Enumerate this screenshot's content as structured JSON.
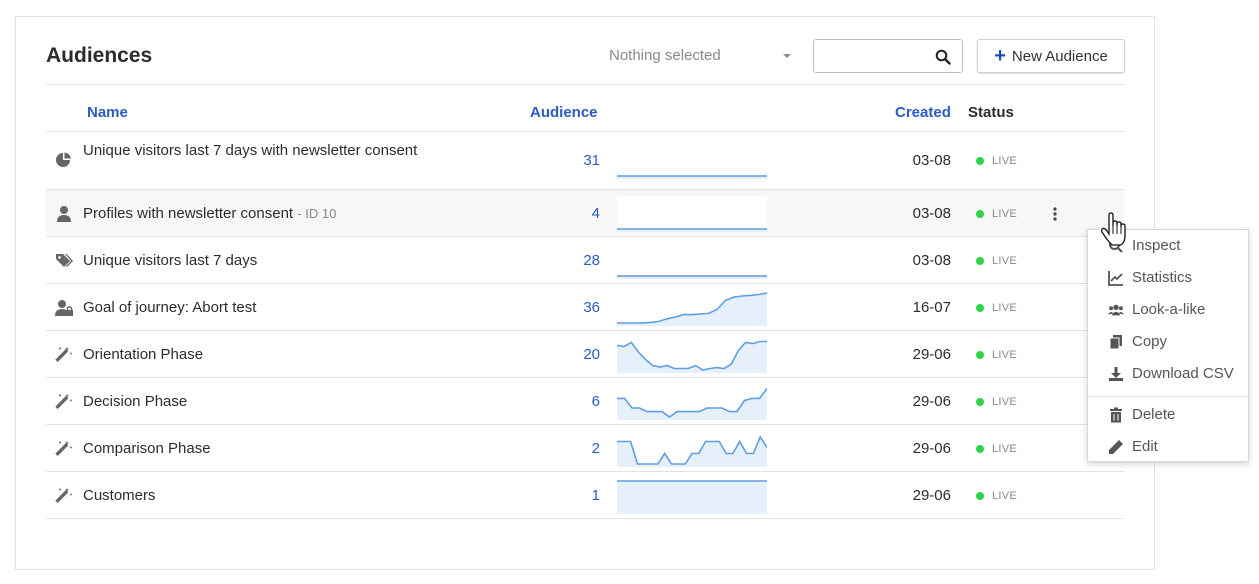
{
  "page": {
    "title": "Audiences"
  },
  "toolbar": {
    "select_value": "Nothing selected",
    "search_value": "",
    "new_label": "New Audience"
  },
  "table": {
    "headers": {
      "name": "Name",
      "audience": "Audience",
      "created": "Created",
      "status": "Status"
    },
    "rows": [
      {
        "icon": "pie-chart-icon",
        "name": "Unique visitors last 7 days with newsletter consent",
        "sub": "",
        "count": "31",
        "created": "03-08",
        "status": "LIVE",
        "trend": [
          0,
          0,
          0,
          0,
          0,
          0,
          0,
          0,
          0,
          0,
          0,
          0,
          0,
          0,
          0,
          0,
          0,
          0,
          0,
          0
        ]
      },
      {
        "icon": "user-icon",
        "name": "Profiles with newsletter consent",
        "sub": "- ID 10",
        "count": "4",
        "created": "03-08",
        "status": "LIVE",
        "trend": [
          0,
          0,
          0,
          0,
          0,
          0,
          0,
          0,
          0,
          0,
          0,
          0,
          0,
          0,
          0,
          0,
          0,
          0,
          0,
          0
        ]
      },
      {
        "icon": "tags-icon",
        "name": "Unique visitors last 7 days",
        "sub": "",
        "count": "28",
        "created": "03-08",
        "status": "LIVE",
        "trend": [
          0,
          0,
          0,
          0,
          0,
          0,
          0,
          0,
          0,
          0,
          0,
          0,
          0,
          0,
          0,
          0,
          0,
          0,
          0,
          0
        ]
      },
      {
        "icon": "user-lock-icon",
        "name": "Goal of journey: Abort test",
        "sub": "",
        "count": "36",
        "created": "16-07",
        "status": "LIVE",
        "trend": [
          0,
          0,
          0,
          0,
          0.02,
          0.05,
          0.14,
          0.2,
          0.28,
          0.28,
          0.3,
          0.32,
          0.45,
          0.75,
          0.86,
          0.9,
          0.92,
          0.95,
          1
        ]
      },
      {
        "icon": "magic-wand-icon",
        "name": "Orientation Phase",
        "sub": "",
        "count": "20",
        "created": "29-06",
        "status": "LIVE",
        "trend": [
          0.82,
          0.78,
          0.92,
          0.6,
          0.35,
          0.15,
          0.1,
          0.15,
          0.05,
          0.05,
          0.05,
          0.15,
          0,
          0.05,
          0.08,
          0.05,
          0.2,
          0.65,
          0.92,
          0.88,
          0.95,
          0.95
        ]
      },
      {
        "icon": "magic-wand-icon",
        "name": "Decision Phase",
        "sub": "",
        "count": "6",
        "created": "29-06",
        "status": "LIVE",
        "trend": [
          0.62,
          0.62,
          0.3,
          0.3,
          0.18,
          0.18,
          0.18,
          0,
          0.18,
          0.18,
          0.18,
          0.18,
          0.3,
          0.3,
          0.3,
          0.18,
          0.18,
          0.55,
          0.62,
          0.62,
          0.95
        ]
      },
      {
        "icon": "magic-wand-icon",
        "name": "Comparison Phase",
        "sub": "",
        "count": "2",
        "created": "29-06",
        "status": "LIVE",
        "trend": [
          0.75,
          0.75,
          0.75,
          0,
          0,
          0,
          0,
          0.35,
          0,
          0,
          0,
          0.35,
          0.35,
          0.75,
          0.75,
          0.75,
          0.35,
          0.35,
          0.75,
          0.35,
          0.35,
          0.9,
          0.55
        ]
      },
      {
        "icon": "magic-wand-icon",
        "name": "Customers",
        "sub": "",
        "count": "1",
        "created": "29-06",
        "status": "LIVE",
        "trend": [
          1,
          1,
          1,
          1,
          1,
          1,
          1,
          1,
          1,
          1
        ]
      }
    ]
  },
  "context_menu": {
    "items": [
      {
        "label": "Inspect",
        "icon": "search-icon"
      },
      {
        "label": "Statistics",
        "icon": "line-chart-icon"
      },
      {
        "label": "Look-a-like",
        "icon": "users-icon"
      },
      {
        "label": "Copy",
        "icon": "copy-icon"
      },
      {
        "label": "Download CSV",
        "icon": "download-icon"
      },
      {
        "label": "Delete",
        "icon": "trash-icon"
      },
      {
        "label": "Edit",
        "icon": "pencil-icon"
      }
    ]
  },
  "colors": {
    "link": "#2a5bc4",
    "brand": "#1e4fb5",
    "live": "#2ed34a",
    "spark_line": "#5e9ee0",
    "spark_fill": "#e6f0fb"
  }
}
